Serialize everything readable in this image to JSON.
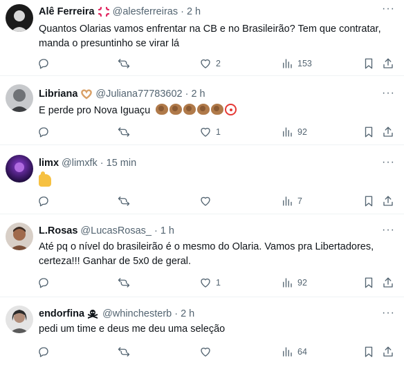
{
  "tweets": [
    {
      "name": "Alê Ferreira",
      "badge_icon": "anger-symbol-icon",
      "handle": "@alesferreiras",
      "dot": "·",
      "time": "2 h",
      "text": "Quantos Olarias vamos enfrentar na CB e no Brasileirão? Tem que contratar, manda o presuntinho se virar lá",
      "likes": "2",
      "views": "153",
      "avatar_color": "#1b1b1b"
    },
    {
      "name": "Libriana",
      "badge_icon": "heart-hands-icon",
      "handle": "@Juliana77783602",
      "dot": "·",
      "time": "2 h",
      "text": "E perde pro Nova Iguaçu",
      "text_emojis": [
        "clap-icon",
        "clap-icon",
        "clap-icon",
        "clap-icon",
        "clap-icon",
        "clown-icon"
      ],
      "likes": "1",
      "views": "92",
      "avatar_color": "#9aa0a6"
    },
    {
      "name": "limx",
      "handle": "@limxfk",
      "dot": "·",
      "time": "15 min",
      "text": "",
      "text_emojis": [
        "thumbs-up-icon"
      ],
      "likes": "",
      "views": "7",
      "avatar_color": "#3a1a7a"
    },
    {
      "name": "L.Rosas",
      "handle": "@LucasRosas_",
      "dot": "·",
      "time": "1 h",
      "text": "Até pq o nível do brasileirão é o mesmo do Olaria. Vamos pra Libertadores, certeza!!! Ganhar de 5x0 de geral.",
      "likes": "1",
      "views": "92",
      "avatar_color": "#6b4a3a"
    },
    {
      "name": "endorfina",
      "badge_icon": "skull-crossbones-icon",
      "handle": "@whinchesterb",
      "dot": "·",
      "time": "2 h",
      "text": "pedi um time e deus me deu uma seleção",
      "likes": "",
      "views": "64",
      "avatar_color": "#8c8c8c"
    }
  ]
}
